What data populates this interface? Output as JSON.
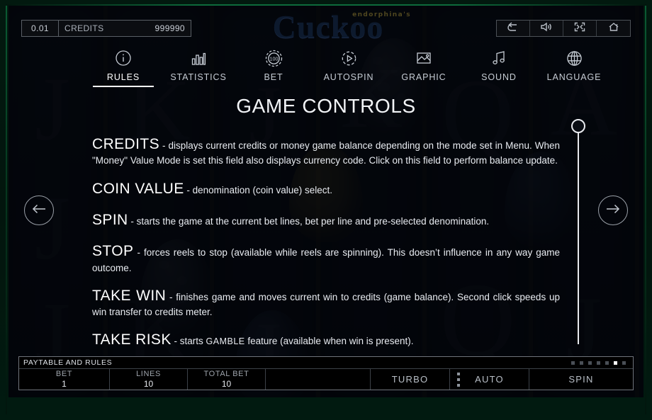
{
  "game": {
    "brand": "endorphina's",
    "title": "Cuckoo"
  },
  "meter": {
    "coin_value": "0.01",
    "credits_label": "CREDITS",
    "credits_value": "999990"
  },
  "top_controls": [
    {
      "name": "back-button",
      "icon": "undo-icon"
    },
    {
      "name": "sound-button",
      "icon": "sound-icon"
    },
    {
      "name": "fullscreen-button",
      "icon": "fullscreen-icon"
    },
    {
      "name": "home-button",
      "icon": "home-icon"
    }
  ],
  "tabs": [
    {
      "label": "RULES",
      "icon": "info-icon",
      "active": true
    },
    {
      "label": "STATISTICS",
      "icon": "bar-chart-icon",
      "active": false
    },
    {
      "label": "BET",
      "icon": "chip-icon",
      "chip_value": "100",
      "active": false
    },
    {
      "label": "AUTOSPIN",
      "icon": "play-circle-icon",
      "active": false
    },
    {
      "label": "GRAPHIC",
      "icon": "image-icon",
      "active": false
    },
    {
      "label": "SOUND",
      "icon": "music-note-icon",
      "active": false
    },
    {
      "label": "LANGUAGE",
      "icon": "globe-icon",
      "active": false
    }
  ],
  "content": {
    "title": "GAME CONTROLS",
    "entries": [
      {
        "term": "CREDITS",
        "text": " - displays current credits or money game balance depending on the mode set in Menu. When \"Money\" Value Mode is set this field also displays currency code. Click on this field to perform balance update."
      },
      {
        "term": "COIN VALUE",
        "text": " - denomination (coin value) select."
      },
      {
        "term": "SPIN",
        "text": " - starts the game at the current bet lines, bet per line and pre-selected denomination."
      },
      {
        "term": "STOP",
        "text": " - forces reels to stop (available while reels are spinning). This doesn’t influence in any way game outcome."
      },
      {
        "term": "TAKE WIN",
        "text": " - finishes game and moves current win to credits (game balance). Second click speeds up win transfer to credits meter."
      },
      {
        "term": "TAKE RISK",
        "text_pre": " - starts ",
        "keyword": "GAMBLE",
        "text_post": " feature (available when win is present)."
      }
    ]
  },
  "navigation": {
    "prev_label": "previous-page",
    "next_label": "next-page"
  },
  "bottom": {
    "paytable_label": "PAYTABLE AND RULES",
    "pagination": {
      "total": 7,
      "active_index": 5
    },
    "meters": [
      {
        "name": "BET",
        "value": "1"
      },
      {
        "name": "LINES",
        "value": "10"
      },
      {
        "name": "TOTAL BET",
        "value": "10"
      }
    ],
    "turbo_label": "TURBO",
    "auto_label": "AUTO",
    "spin_label": "SPIN"
  },
  "colors": {
    "frame_green": "#0d6b3c",
    "accent_white": "#ffffff",
    "text_primary": "#e9ecf1",
    "text_muted": "#9ea4ac",
    "logo_navy": "#0d1a2e",
    "logo_gold": "#5d5223"
  }
}
